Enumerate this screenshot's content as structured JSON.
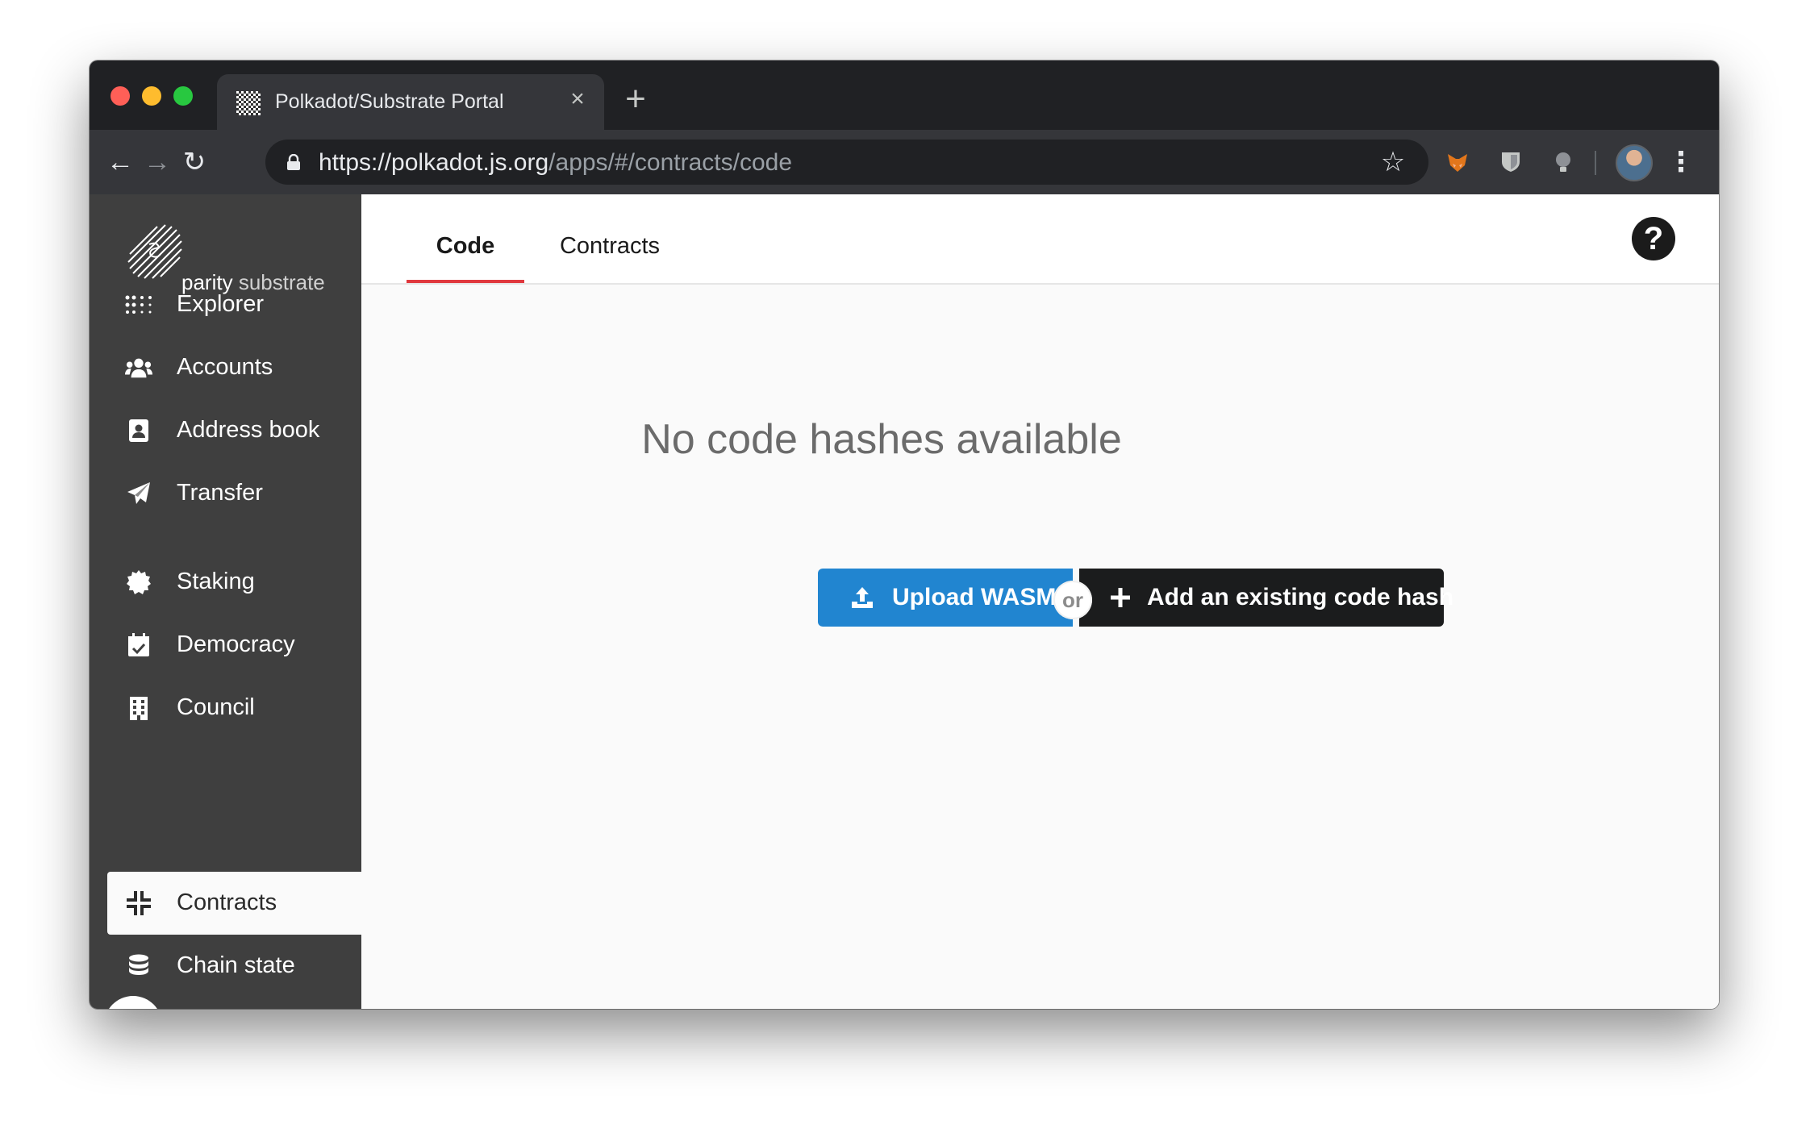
{
  "browser": {
    "tab_title": "Polkadot/Substrate Portal",
    "url_host": "https://polkadot.js.org",
    "url_path": "/apps/#/contracts/code"
  },
  "sidebar": {
    "logo_word1": "parity",
    "logo_word2": "substrate",
    "items": [
      {
        "label": "Explorer",
        "icon": "grid-dots-icon"
      },
      {
        "label": "Accounts",
        "icon": "users-icon"
      },
      {
        "label": "Address book",
        "icon": "address-book-icon"
      },
      {
        "label": "Transfer",
        "icon": "paper-plane-icon"
      },
      {
        "label": "Staking",
        "icon": "certificate-icon"
      },
      {
        "label": "Democracy",
        "icon": "calendar-check-icon"
      },
      {
        "label": "Council",
        "icon": "building-icon"
      },
      {
        "label": "Contracts",
        "icon": "compress-icon",
        "active": true
      },
      {
        "label": "Chain state",
        "icon": "database-icon"
      }
    ],
    "collapse_glyph": "«"
  },
  "main": {
    "tabs": [
      {
        "label": "Code",
        "active": true
      },
      {
        "label": "Contracts",
        "active": false
      }
    ],
    "empty_message": "No code hashes available",
    "upload_label": "Upload WASM",
    "or_label": "or",
    "add_label": "Add an existing code hash"
  },
  "colors": {
    "accent_blue": "#2185d0",
    "active_tab_underline": "#e0393e",
    "sidebar_bg": "#3f3f3f"
  }
}
